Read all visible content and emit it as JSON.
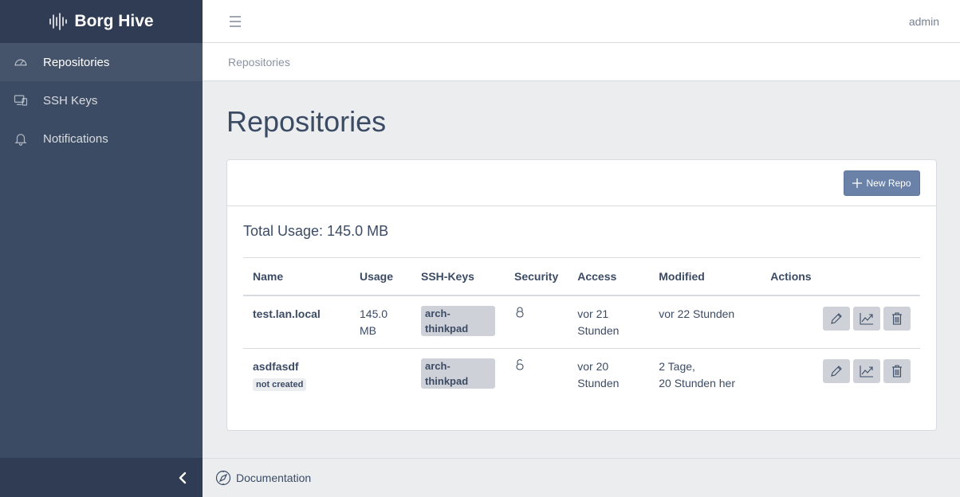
{
  "brand": {
    "name": "Borg Hive",
    "logo_icon": "sound-wave-icon"
  },
  "sidebar": {
    "items": [
      {
        "label": "Repositories",
        "icon": "speedometer-icon",
        "active": true
      },
      {
        "label": "SSH Keys",
        "icon": "devices-icon",
        "active": false
      },
      {
        "label": "Notifications",
        "icon": "bell-icon",
        "active": false
      }
    ],
    "toggler_icon": "chevron-left-icon"
  },
  "header": {
    "user": "admin",
    "menu_icon": "hamburger-icon"
  },
  "breadcrumb": {
    "current": "Repositories"
  },
  "page": {
    "title": "Repositories",
    "new_button_label": "New Repo",
    "total_usage": "Total Usage: 145.0 MB"
  },
  "table": {
    "columns": [
      "Name",
      "Usage",
      "SSH-Keys",
      "Security",
      "Access",
      "Modified",
      "Actions"
    ],
    "rows": [
      {
        "name": "test.lan.local",
        "status": "",
        "usage_line1": "145.0",
        "usage_line2": "MB",
        "ssh_key": "arch-thinkpad",
        "security_icon": "lock-icon",
        "access_line1": "vor 21",
        "access_line2": "Stunden",
        "modified_line1": "vor 22 Stunden",
        "modified_line2": ""
      },
      {
        "name": "asdfasdf",
        "status": "not created",
        "usage_line1": "",
        "usage_line2": "",
        "ssh_key": "arch-thinkpad",
        "security_icon": "lock-unlocked-icon",
        "access_line1": "vor 20",
        "access_line2": "Stunden",
        "modified_line1": "2 Tage,",
        "modified_line2": "20 Stunden her"
      }
    ]
  },
  "footer": {
    "link": "Documentation",
    "icon": "compass-icon"
  },
  "colors": {
    "sidebar": "#3c4b64",
    "brand_bg": "#303c54",
    "button": "#6b82a8",
    "page_bg": "#ebedef"
  }
}
